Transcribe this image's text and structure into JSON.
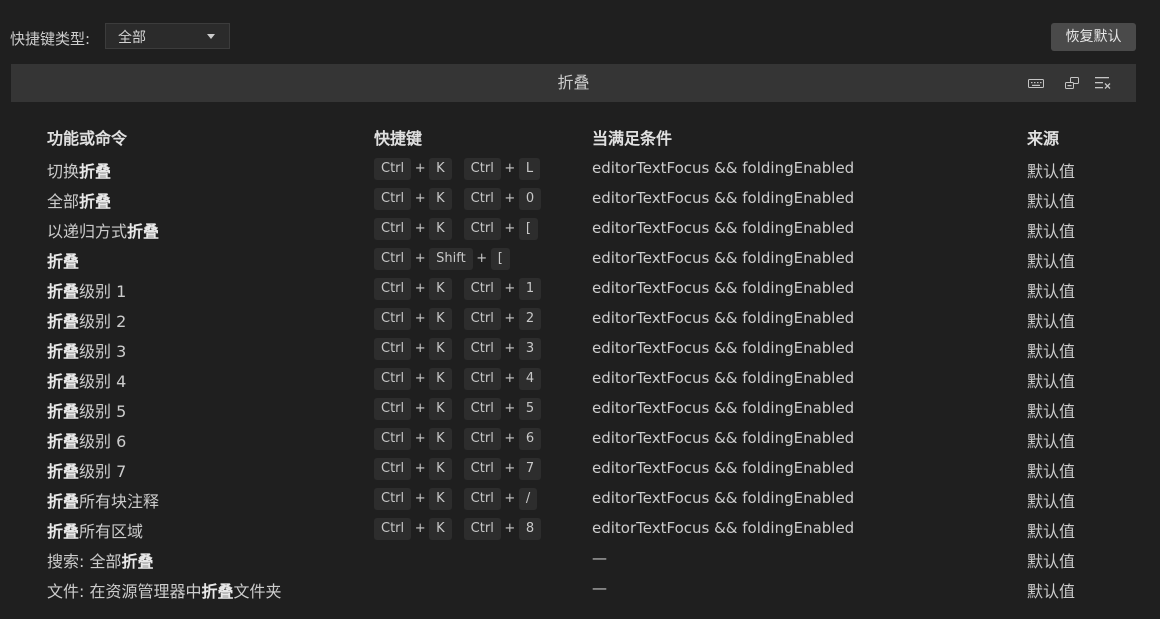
{
  "toolbar": {
    "type_label": "快捷键类型:",
    "type_value": "全部",
    "restore_label": "恢复默认"
  },
  "search": {
    "value": "折叠"
  },
  "headers": {
    "command": "功能或命令",
    "keybinding": "快捷键",
    "when": "当满足条件",
    "source": "来源"
  },
  "rows": [
    {
      "cmd_pre": "切换",
      "cmd_hl": "折叠",
      "cmd_post": "",
      "chord1": [
        "Ctrl",
        "K"
      ],
      "chord2": [
        "Ctrl",
        "L"
      ],
      "when": "editorTextFocus && foldingEnabled",
      "source": "默认值"
    },
    {
      "cmd_pre": "全部",
      "cmd_hl": "折叠",
      "cmd_post": "",
      "chord1": [
        "Ctrl",
        "K"
      ],
      "chord2": [
        "Ctrl",
        "0"
      ],
      "when": "editorTextFocus && foldingEnabled",
      "source": "默认值"
    },
    {
      "cmd_pre": "以递归方式",
      "cmd_hl": "折叠",
      "cmd_post": "",
      "chord1": [
        "Ctrl",
        "K"
      ],
      "chord2": [
        "Ctrl",
        "["
      ],
      "when": "editorTextFocus && foldingEnabled",
      "source": "默认值"
    },
    {
      "cmd_pre": "",
      "cmd_hl": "折叠",
      "cmd_post": "",
      "chord1": [
        "Ctrl",
        "Shift",
        "["
      ],
      "chord2": [],
      "when": "editorTextFocus && foldingEnabled",
      "source": "默认值"
    },
    {
      "cmd_pre": "",
      "cmd_hl": "折叠",
      "cmd_post": "级别 1",
      "chord1": [
        "Ctrl",
        "K"
      ],
      "chord2": [
        "Ctrl",
        "1"
      ],
      "when": "editorTextFocus && foldingEnabled",
      "source": "默认值"
    },
    {
      "cmd_pre": "",
      "cmd_hl": "折叠",
      "cmd_post": "级别 2",
      "chord1": [
        "Ctrl",
        "K"
      ],
      "chord2": [
        "Ctrl",
        "2"
      ],
      "when": "editorTextFocus && foldingEnabled",
      "source": "默认值"
    },
    {
      "cmd_pre": "",
      "cmd_hl": "折叠",
      "cmd_post": "级别 3",
      "chord1": [
        "Ctrl",
        "K"
      ],
      "chord2": [
        "Ctrl",
        "3"
      ],
      "when": "editorTextFocus && foldingEnabled",
      "source": "默认值"
    },
    {
      "cmd_pre": "",
      "cmd_hl": "折叠",
      "cmd_post": "级别 4",
      "chord1": [
        "Ctrl",
        "K"
      ],
      "chord2": [
        "Ctrl",
        "4"
      ],
      "when": "editorTextFocus && foldingEnabled",
      "source": "默认值"
    },
    {
      "cmd_pre": "",
      "cmd_hl": "折叠",
      "cmd_post": "级别 5",
      "chord1": [
        "Ctrl",
        "K"
      ],
      "chord2": [
        "Ctrl",
        "5"
      ],
      "when": "editorTextFocus && foldingEnabled",
      "source": "默认值"
    },
    {
      "cmd_pre": "",
      "cmd_hl": "折叠",
      "cmd_post": "级别 6",
      "chord1": [
        "Ctrl",
        "K"
      ],
      "chord2": [
        "Ctrl",
        "6"
      ],
      "when": "editorTextFocus && foldingEnabled",
      "source": "默认值"
    },
    {
      "cmd_pre": "",
      "cmd_hl": "折叠",
      "cmd_post": "级别 7",
      "chord1": [
        "Ctrl",
        "K"
      ],
      "chord2": [
        "Ctrl",
        "7"
      ],
      "when": "editorTextFocus && foldingEnabled",
      "source": "默认值"
    },
    {
      "cmd_pre": "",
      "cmd_hl": "折叠",
      "cmd_post": "所有块注释",
      "chord1": [
        "Ctrl",
        "K"
      ],
      "chord2": [
        "Ctrl",
        "/"
      ],
      "when": "editorTextFocus && foldingEnabled",
      "source": "默认值"
    },
    {
      "cmd_pre": "",
      "cmd_hl": "折叠",
      "cmd_post": "所有区域",
      "chord1": [
        "Ctrl",
        "K"
      ],
      "chord2": [
        "Ctrl",
        "8"
      ],
      "when": "editorTextFocus && foldingEnabled",
      "source": "默认值"
    },
    {
      "cmd_pre": "搜索: 全部",
      "cmd_hl": "折叠",
      "cmd_post": "",
      "chord1": [],
      "chord2": [],
      "when": "—",
      "source": "默认值"
    },
    {
      "cmd_pre": "文件: 在资源管理器中",
      "cmd_hl": "折叠",
      "cmd_post": "文件夹",
      "chord1": [],
      "chord2": [],
      "when": "—",
      "source": "默认值"
    }
  ]
}
